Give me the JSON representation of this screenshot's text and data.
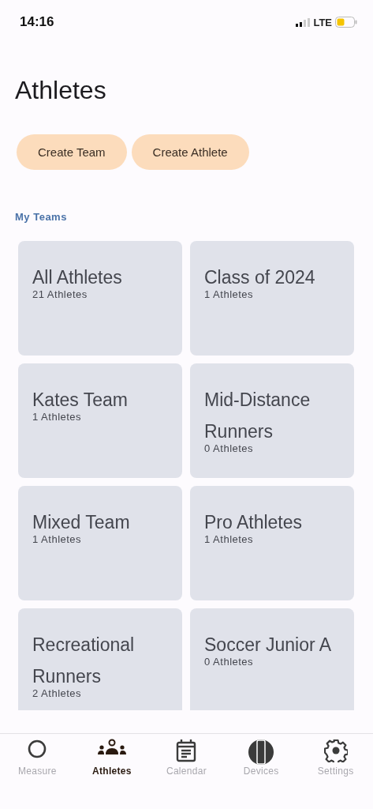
{
  "status_bar": {
    "time": "14:16",
    "network": "LTE"
  },
  "title": "Athletes",
  "actions": [
    "Create Team",
    "Create Athlete"
  ],
  "section_label": "My Teams",
  "teams": [
    {
      "name": "All Athletes",
      "count": "21 Athletes"
    },
    {
      "name": "Class of 2024",
      "count": "1 Athletes"
    },
    {
      "name": "Kates Team",
      "count": "1 Athletes"
    },
    {
      "name": "Mid-Distance Runners",
      "count": "0 Athletes"
    },
    {
      "name": "Mixed Team",
      "count": "1 Athletes"
    },
    {
      "name": "Pro Athletes",
      "count": "1 Athletes"
    },
    {
      "name": "Recreational Runners",
      "count": "2 Athletes"
    },
    {
      "name": "Soccer Junior A",
      "count": "0 Athletes"
    }
  ],
  "tab_bar": [
    {
      "label": "Measure",
      "selected": false
    },
    {
      "label": "Athletes",
      "selected": true
    },
    {
      "label": "Calendar",
      "selected": false
    },
    {
      "label": "Devices",
      "selected": false
    },
    {
      "label": "Settings",
      "selected": false
    }
  ]
}
